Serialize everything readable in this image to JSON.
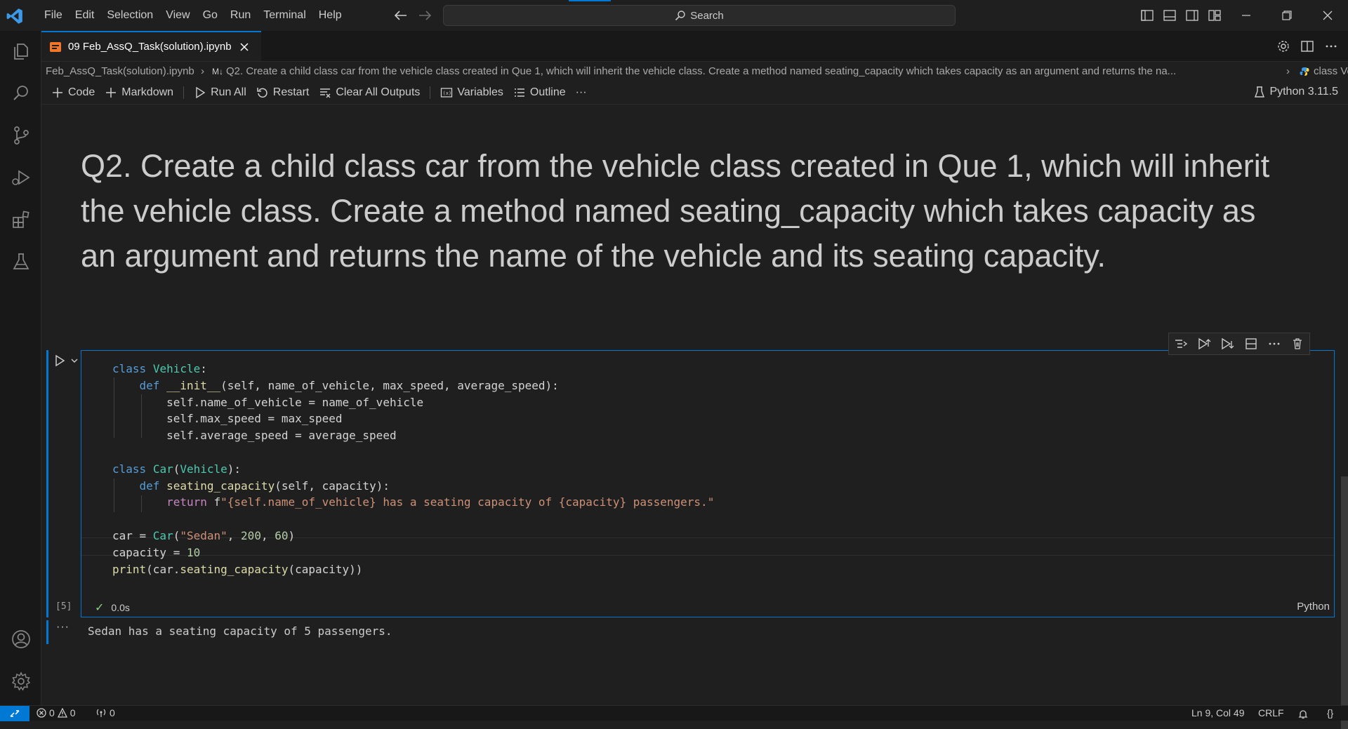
{
  "menu": [
    "File",
    "Edit",
    "Selection",
    "View",
    "Go",
    "Run",
    "Terminal",
    "Help"
  ],
  "search": {
    "label": "Search"
  },
  "tab": {
    "title": "09 Feb_AssQ_Task(solution).ipynb"
  },
  "breadcrumb": {
    "file": "Feb_AssQ_Task(solution).ipynb",
    "section_prefix": "M↓",
    "section": "Q2.  Create a child class car from the vehicle class created in Que 1, which will inherit the vehicle class. Create a method named seating_capacity which takes capacity as an argument and returns the na...",
    "symbol": "class Vehicle:"
  },
  "toolbar": {
    "code": "Code",
    "markdown": "Markdown",
    "run_all": "Run All",
    "restart": "Restart",
    "clear_outputs": "Clear All Outputs",
    "variables": "Variables",
    "outline": "Outline",
    "more": "···",
    "kernel": "Python 3.11.5"
  },
  "markdown_cell": {
    "heading": "Q2.  Create a child class car from the vehicle class created in Que 1, which will inherit the vehicle class. Create a method named seating_capacity which takes capacity as an argument and returns the name of the vehicle and its seating capacity."
  },
  "code_cell": {
    "execution_count": "[5]",
    "status_check": "✓",
    "duration": "0.0s",
    "language": "Python",
    "lines": [
      "class Vehicle:",
      "    def __init__(self, name_of_vehicle, max_speed, average_speed):",
      "        self.name_of_vehicle = name_of_vehicle",
      "        self.max_speed = max_speed",
      "        self.average_speed = average_speed",
      "",
      "class Car(Vehicle):",
      "    def seating_capacity(self, capacity):",
      "        return f\"{self.name_of_vehicle} has a seating capacity of {capacity} passengers.\"",
      "",
      "car = Car(\"Sedan\", 200, 60)",
      "capacity = 10",
      "print(car.seating_capacity(capacity))"
    ],
    "output_more": "···",
    "output": "Sedan has a seating capacity of 5 passengers."
  },
  "statusbar": {
    "errors": "0",
    "warnings": "0",
    "ports": "0",
    "position": "Ln 9, Col 49",
    "eol": "CRLF",
    "braces": "{}"
  },
  "colors": {
    "accent": "#0078d4",
    "background": "#1f1f1f",
    "sidebar": "#181818"
  },
  "icons": [
    "vscode-logo",
    "files-icon",
    "search-icon",
    "source-control-icon",
    "run-debug-icon",
    "extensions-icon",
    "testing-icon",
    "account-icon",
    "gear-icon"
  ]
}
